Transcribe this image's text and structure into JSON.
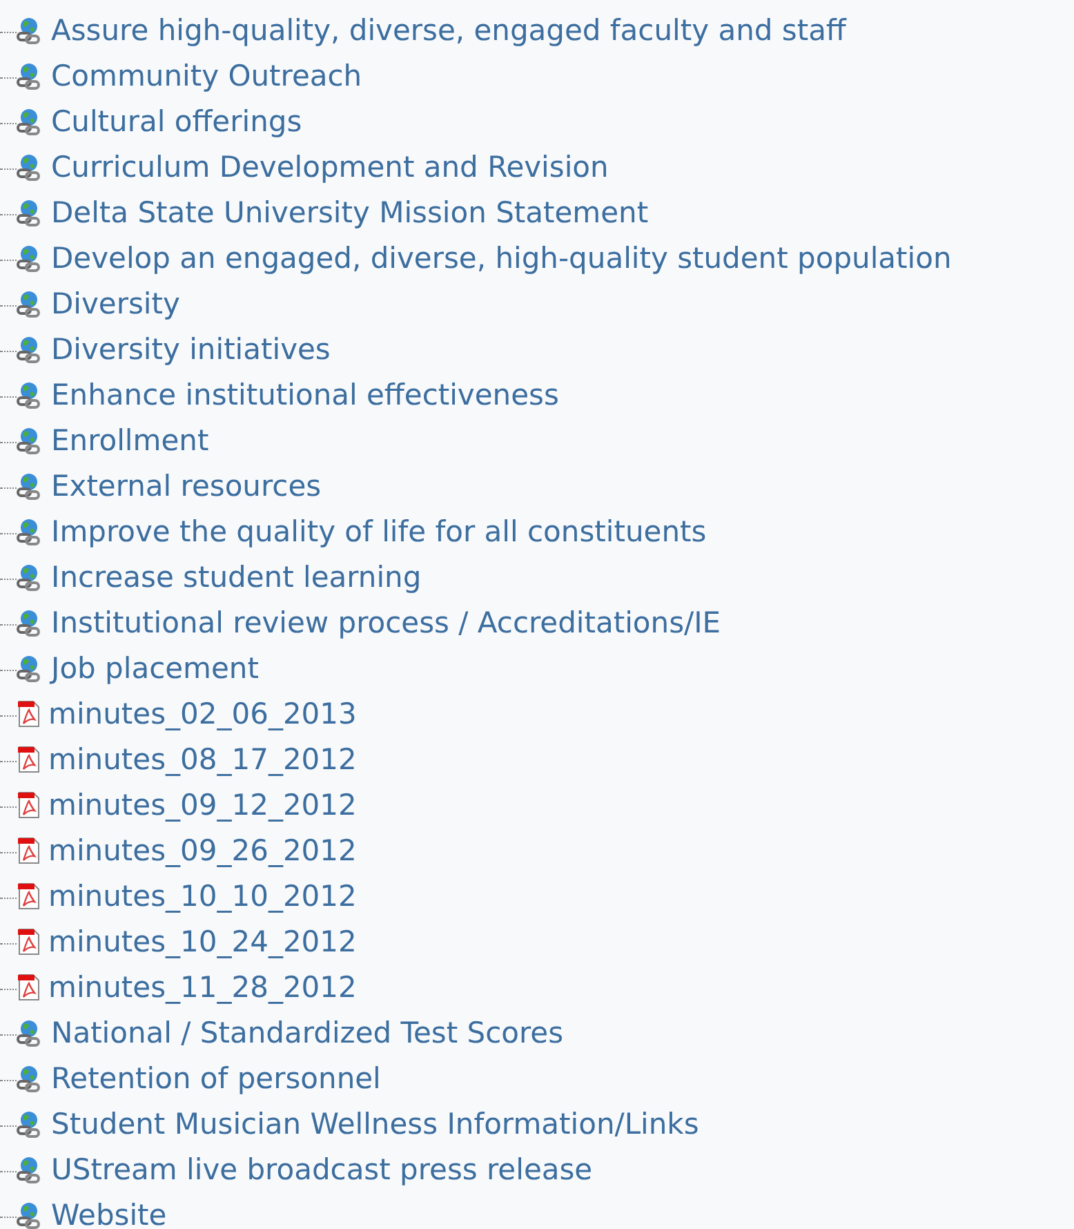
{
  "items": [
    {
      "kind": "link",
      "label": "Assure high-quality, diverse, engaged faculty and staff"
    },
    {
      "kind": "link",
      "label": "Community Outreach"
    },
    {
      "kind": "link",
      "label": "Cultural offerings"
    },
    {
      "kind": "link",
      "label": "Curriculum Development and Revision"
    },
    {
      "kind": "link",
      "label": "Delta State University Mission Statement"
    },
    {
      "kind": "link",
      "label": "Develop an engaged, diverse, high-quality student population"
    },
    {
      "kind": "link",
      "label": "Diversity"
    },
    {
      "kind": "link",
      "label": "Diversity initiatives"
    },
    {
      "kind": "link",
      "label": "Enhance institutional effectiveness"
    },
    {
      "kind": "link",
      "label": "Enrollment"
    },
    {
      "kind": "link",
      "label": "External resources"
    },
    {
      "kind": "link",
      "label": "Improve the quality of life for all constituents"
    },
    {
      "kind": "link",
      "label": "Increase student learning"
    },
    {
      "kind": "link",
      "label": "Institutional review process / Accreditations/IE"
    },
    {
      "kind": "link",
      "label": "Job placement"
    },
    {
      "kind": "pdf",
      "label": "minutes_02_06_2013"
    },
    {
      "kind": "pdf",
      "label": "minutes_08_17_2012"
    },
    {
      "kind": "pdf",
      "label": "minutes_09_12_2012"
    },
    {
      "kind": "pdf",
      "label": "minutes_09_26_2012"
    },
    {
      "kind": "pdf",
      "label": "minutes_10_10_2012"
    },
    {
      "kind": "pdf",
      "label": "minutes_10_24_2012"
    },
    {
      "kind": "pdf",
      "label": "minutes_11_28_2012"
    },
    {
      "kind": "link",
      "label": "National / Standardized Test Scores"
    },
    {
      "kind": "link",
      "label": "Retention of personnel"
    },
    {
      "kind": "link",
      "label": "Student Musician Wellness Information/Links"
    },
    {
      "kind": "link",
      "label": "UStream live broadcast press release"
    },
    {
      "kind": "link",
      "label": "Website"
    }
  ]
}
